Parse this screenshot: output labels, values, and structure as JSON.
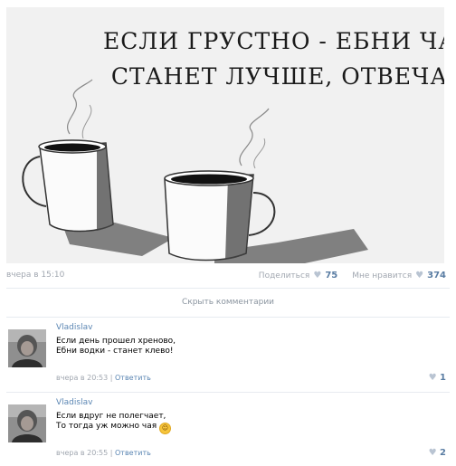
{
  "post": {
    "image_text_line1": "ЕСЛИ ГРУСТНО - ЕБНИ ЧАЮ.",
    "image_text_line2": "СТАНЕТ ЛУЧШЕ, ОТВЕЧАЮ.",
    "date": "вчера в 15:10",
    "share_label": "Поделиться",
    "share_count": "75",
    "like_label": "Мне нравится",
    "like_count": "374"
  },
  "comments_toggle": "Скрыть комментарии",
  "comments": [
    {
      "author": "Vladislav",
      "line1": "Если день прошел хреново,",
      "line2": "Ебни водки - станет клево!",
      "date": "вчера в 20:53",
      "separator": "|",
      "reply": "Ответить",
      "likes": "1"
    },
    {
      "author": "Vladislav",
      "line1": "Если вдруг не полегчает,",
      "line2": "То тогда уж можно чая",
      "date": "вчера в 20:55",
      "separator": "|",
      "reply": "Ответить",
      "likes": "2"
    }
  ],
  "icons": {
    "heart": "♥",
    "smiley": "☺"
  },
  "colors": {
    "link": "#5b86b3",
    "muted": "#a1a7b0",
    "count": "#5a7da3"
  }
}
